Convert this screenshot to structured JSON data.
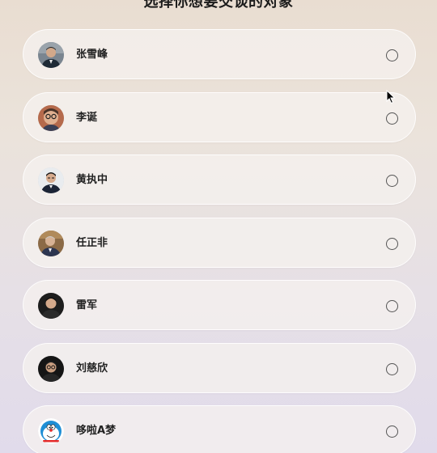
{
  "page": {
    "title": "选择你想要交谈的对象"
  },
  "contacts": [
    {
      "name": "张雪峰",
      "avatar_icon": "person-avatar-icon",
      "selected": false
    },
    {
      "name": "李诞",
      "avatar_icon": "person-avatar-icon",
      "selected": false
    },
    {
      "name": "黄执中",
      "avatar_icon": "person-avatar-icon",
      "selected": false
    },
    {
      "name": "任正非",
      "avatar_icon": "person-avatar-icon",
      "selected": false
    },
    {
      "name": "雷军",
      "avatar_icon": "person-avatar-icon",
      "selected": false
    },
    {
      "name": "刘慈欣",
      "avatar_icon": "person-avatar-icon",
      "selected": false
    },
    {
      "name": "哆啦A梦",
      "avatar_icon": "doraemon-avatar-icon",
      "selected": false
    }
  ],
  "colors": {
    "text": "#222222",
    "radio_border": "#555555",
    "card_bg": "#f5f1ee"
  }
}
